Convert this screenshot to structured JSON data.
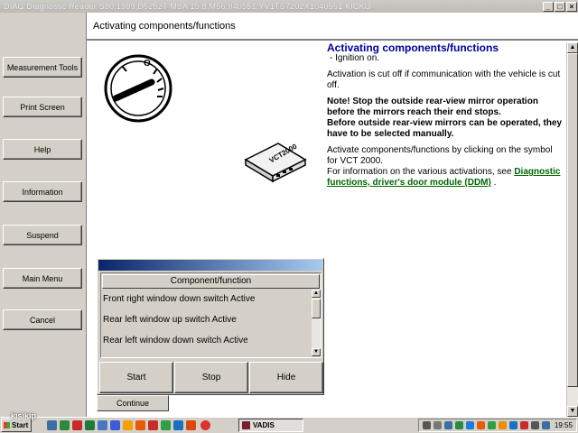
{
  "window": {
    "title": "DIAG Diagnostic Reader S80,1999,D5252T MSA 15.8,M56,040551,YV1TS7202X1040551 KICKU"
  },
  "sidebar": {
    "items": [
      {
        "label": "Measurement Tools"
      },
      {
        "label": "Print Screen"
      },
      {
        "label": "Help"
      },
      {
        "label": "Information"
      },
      {
        "label": "Suspend"
      },
      {
        "label": "Main Menu"
      },
      {
        "label": "Cancel"
      }
    ]
  },
  "header": {
    "title": "Activating components/functions"
  },
  "content": {
    "heading": "Activating components/functions",
    "bullet": "-  Ignition on.",
    "para1": "Activation is cut off if communication with the vehicle is cut off.",
    "note1": "Note! Stop the outside rear-view mirror operation before the mirrors reach their end stops.",
    "note2": "Before outside rear-view mirrors can be operated, they have to be selected manually.",
    "para2": "Activate components/functions by clicking on the symbol for VCT 2000.",
    "para3": "For information on the various activations, see",
    "link": "Diagnostic functions, driver's door module (DDM)",
    "period": ".",
    "device_label": "VCT2000"
  },
  "dialog": {
    "column_header": "Component/function",
    "items": [
      "Front right window down switch Active",
      "Rear left window up switch Active",
      "Rear left window down switch Active"
    ],
    "start": "Start",
    "stop": "Stop",
    "hide": "Hide"
  },
  "continue_label": "Continue",
  "taskbar": {
    "start": "Start",
    "task": "VADIS",
    "clock": "19:55"
  },
  "watermark": "kisikip",
  "colors": {
    "heading": "#0000a0",
    "link": "#006600",
    "dialog_title": "#0a246a"
  }
}
